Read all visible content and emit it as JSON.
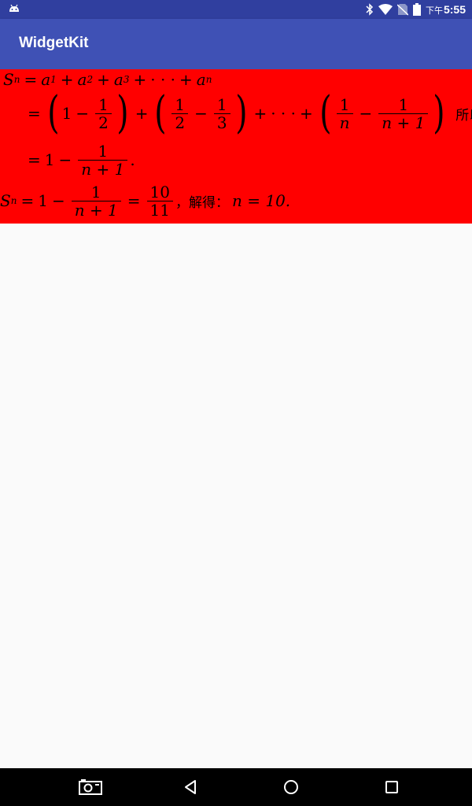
{
  "status_bar": {
    "time_period": "下午",
    "time": "5:55",
    "icons": [
      "android-icon",
      "bluetooth-icon",
      "wifi-icon",
      "no-sim-icon",
      "battery-icon"
    ]
  },
  "app_bar": {
    "title": "WidgetKit"
  },
  "math": {
    "line1": {
      "S": "S",
      "n": "n",
      "eq": "=",
      "a": "a",
      "s1": "1",
      "s2": "2",
      "s3": "3",
      "plus": "+",
      "dots": "· · ·",
      "sn": "n"
    },
    "line2": {
      "eq": "=",
      "t1_whole": "1",
      "minus": "−",
      "t1_num": "1",
      "t1_den": "2",
      "plus": "+",
      "t2_num1": "1",
      "t2_den1": "2",
      "t2_num2": "1",
      "t2_den2": "3",
      "dots": "· · ·",
      "t3_num1": "1",
      "t3_den1": "n",
      "t3_num2": "1",
      "t3_den2": "n + 1",
      "suffix": "所以"
    },
    "line3": {
      "eq": "=",
      "one": "1",
      "minus": "−",
      "num": "1",
      "den": "n + 1",
      "end": "."
    },
    "line4": {
      "S": "S",
      "n": "n",
      "eq": "=",
      "one": "1",
      "minus": "−",
      "num": "1",
      "den": "n + 1",
      "eq2": "=",
      "num2": "10",
      "den2": "11",
      "comma": "，",
      "solve": "解得：",
      "result": "n = 10."
    }
  },
  "nav_bar": {
    "buttons": [
      "screenshot-icon",
      "back-icon",
      "home-icon",
      "recents-icon"
    ]
  },
  "colors": {
    "status_bar": "#303f9f",
    "app_bar": "#3f51b5",
    "math_bg": "#ff0000",
    "page_bg": "#fafafa",
    "nav_bar": "#000000"
  }
}
